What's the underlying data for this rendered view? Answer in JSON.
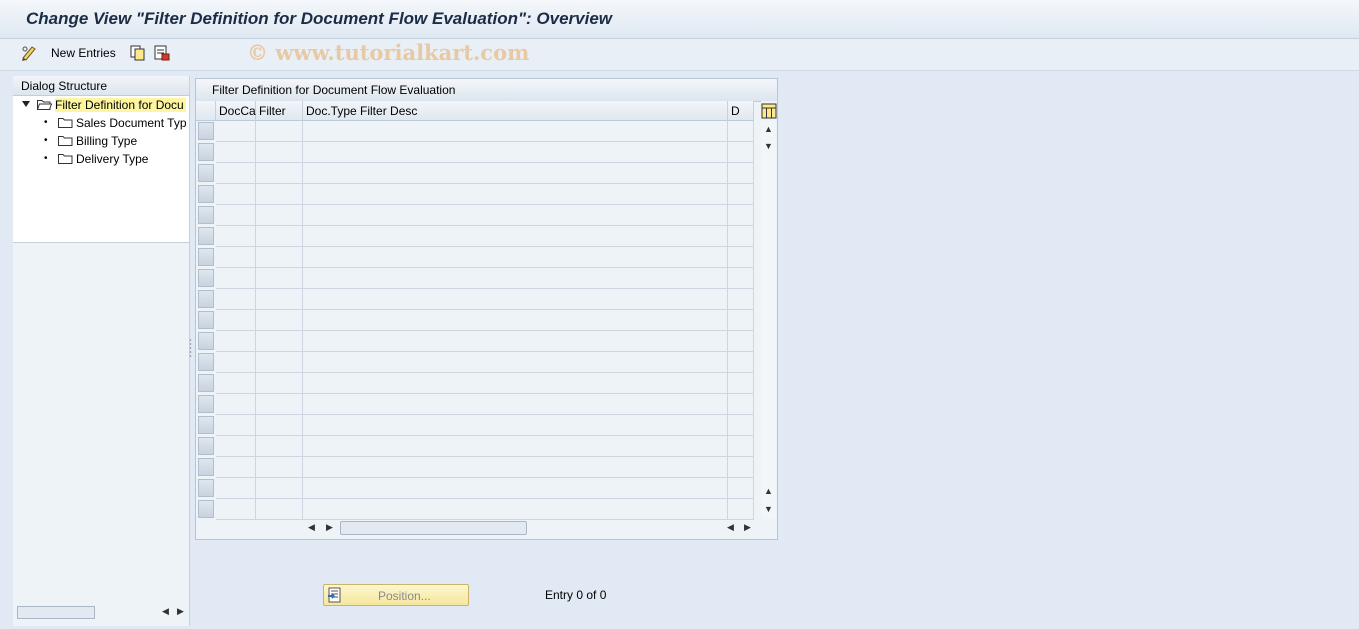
{
  "window": {
    "title": "Change View \"Filter Definition for Document Flow Evaluation\": Overview"
  },
  "toolbar": {
    "new_entries_label": "New Entries",
    "watermark": "© www.tutorialkart.com",
    "icons": [
      "change-display-icon",
      "copy-icon",
      "delete-icon"
    ]
  },
  "dialog_structure": {
    "header": "Dialog Structure",
    "items": [
      {
        "label": "Filter Definition for Docu",
        "selected": true,
        "icon": "folder-open-icon"
      },
      {
        "label": "Sales Document Typ",
        "selected": false,
        "icon": "folder-icon"
      },
      {
        "label": "Billing Type",
        "selected": false,
        "icon": "folder-icon"
      },
      {
        "label": "Delivery Type",
        "selected": false,
        "icon": "folder-icon"
      }
    ]
  },
  "table": {
    "caption": "Filter Definition for Document Flow Evaluation",
    "columns": [
      "DocCa",
      "Filter",
      "Doc.Type Filter Desc",
      "D"
    ],
    "rows": []
  },
  "footer": {
    "position_button_label": "Position...",
    "entry_text": "Entry 0 of 0"
  },
  "colors": {
    "selected_tree_bg": "#fdf5a0",
    "position_button_bg": "#f8eab0",
    "background": "#e1eaf4"
  }
}
